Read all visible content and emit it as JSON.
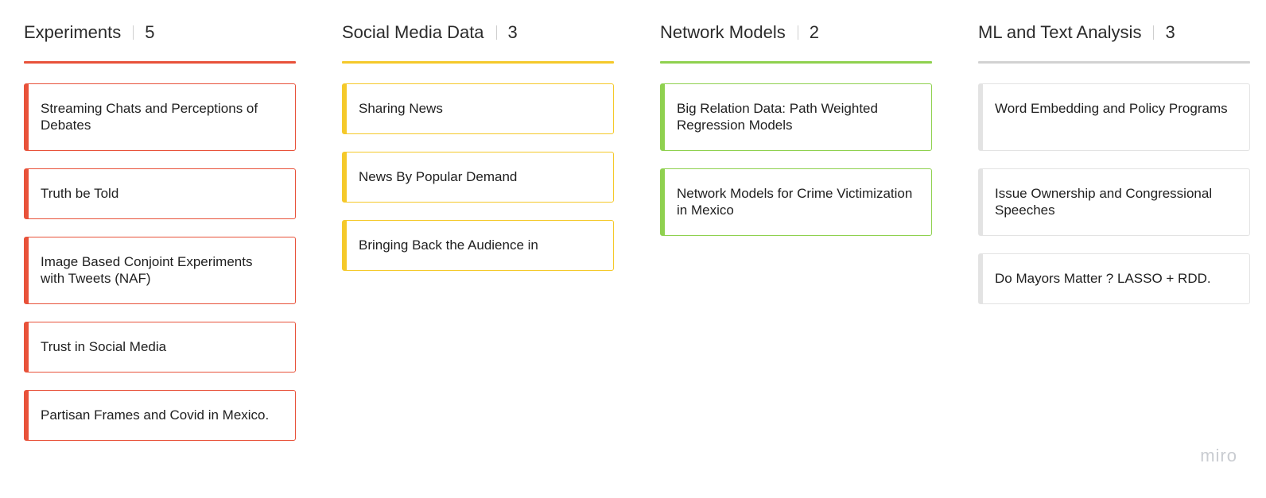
{
  "columns": [
    {
      "title": "Experiments",
      "count": "5",
      "color": "#e8523a",
      "cards": [
        {
          "text": "Streaming Chats and Perceptions of Debates",
          "lines": 2
        },
        {
          "text": "Truth be Told",
          "lines": 1
        },
        {
          "text": "Image Based Conjoint Experiments with Tweets (NAF)",
          "lines": 2
        },
        {
          "text": "Trust in Social Media",
          "lines": 1
        },
        {
          "text": "Partisan Frames and Covid in Mexico.",
          "lines": 1
        }
      ]
    },
    {
      "title": "Social Media Data",
      "count": "3",
      "color": "#f5c92a",
      "cards": [
        {
          "text": "Sharing News",
          "lines": 1
        },
        {
          "text": "News By Popular Demand",
          "lines": 1
        },
        {
          "text": "Bringing Back the Audience in",
          "lines": 1
        }
      ]
    },
    {
      "title": "Network Models",
      "count": "2",
      "color": "#8fd14f",
      "cards": [
        {
          "text": "Big Relation Data: Path Weighted Regression Models",
          "lines": 2
        },
        {
          "text": "Network Models for Crime Victimization in Mexico",
          "lines": 2
        }
      ]
    },
    {
      "title": "ML and Text Analysis",
      "count": "3",
      "color": "#e3e3e3",
      "rule_color": "#d2d2d2",
      "cards": [
        {
          "text": "Word Embedding and Policy Programs",
          "lines": 2
        },
        {
          "text": "Issue Ownership and Congressional Speeches",
          "lines": 2
        },
        {
          "text": "Do Mayors Matter ? LASSO + RDD.",
          "lines": 1
        }
      ]
    }
  ],
  "watermark": "miro"
}
